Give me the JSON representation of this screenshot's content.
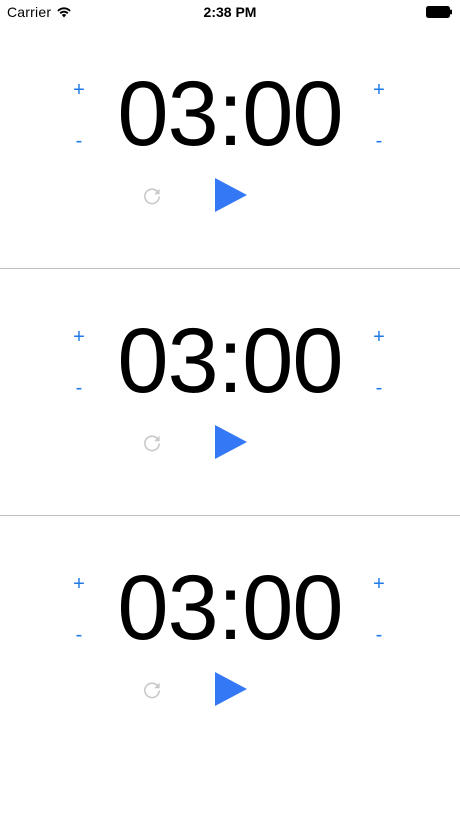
{
  "status_bar": {
    "carrier": "Carrier",
    "time": "2:38 PM",
    "icons": [
      "wifi-icon",
      "battery-icon"
    ]
  },
  "timers": [
    {
      "time": "03:00",
      "plus_label": "+",
      "minus_label": "-",
      "icons": [
        "reset-icon",
        "play-icon"
      ]
    },
    {
      "time": "03:00",
      "plus_label": "+",
      "minus_label": "-",
      "icons": [
        "reset-icon",
        "play-icon"
      ]
    },
    {
      "time": "03:00",
      "plus_label": "+",
      "minus_label": "-",
      "icons": [
        "reset-icon",
        "play-icon"
      ]
    }
  ],
  "colors": {
    "accent": "#1f7ae8",
    "play": "#3478f6",
    "reset": "#c8c8c8",
    "divider": "#bdbdbd",
    "text": "#000000"
  }
}
